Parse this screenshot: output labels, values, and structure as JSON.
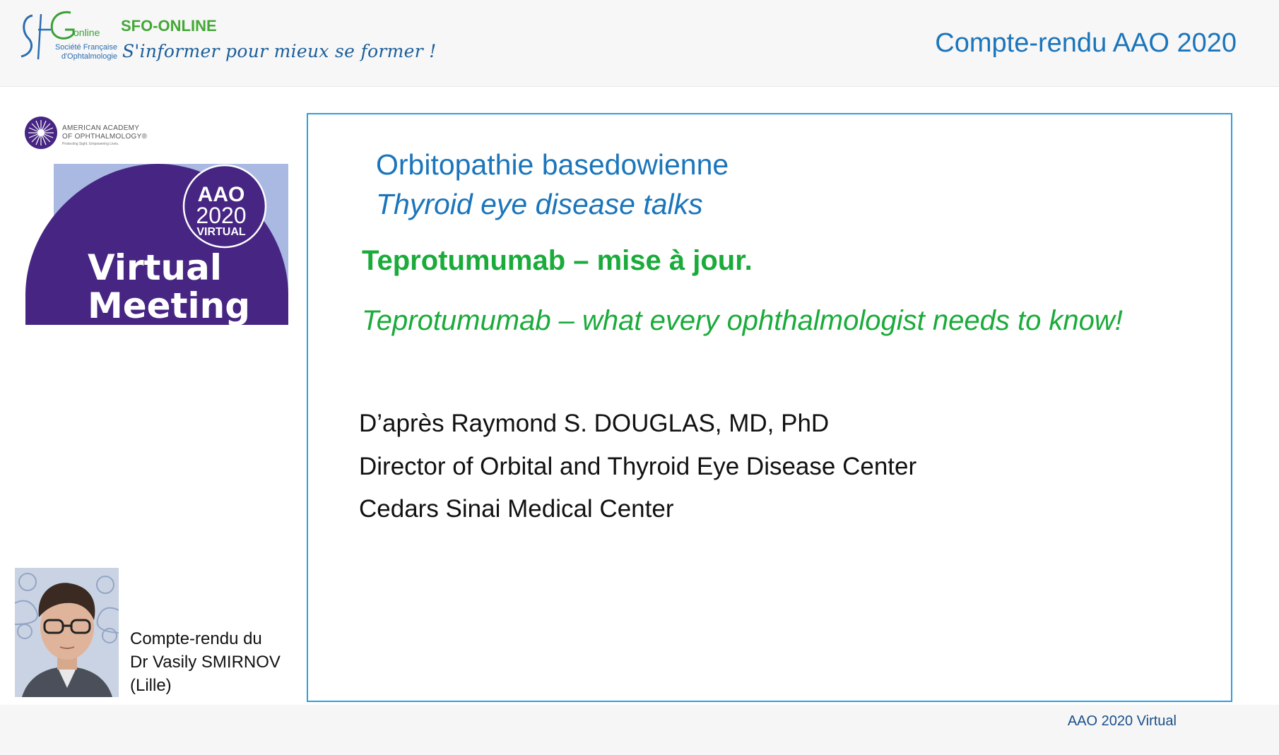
{
  "header": {
    "logo": {
      "mark": "SF",
      "word": "online",
      "society_line1": "Société Française",
      "society_line2": "d'Ophtalmologie"
    },
    "brand_name": "SFO-ONLINE",
    "tagline": "S'informer pour mieux se former !",
    "title": "Compte-rendu AAO 2020"
  },
  "aao_logo": {
    "name_line1": "AMERICAN ACADEMY",
    "name_line2": "OF OPHTHALMOLOGY®",
    "motto": "Protecting Sight. Empowering Lives."
  },
  "virtual_meeting_logo": {
    "badge_aao": "AAO",
    "badge_year": "2020",
    "badge_virtual": "VIRTUAL",
    "line1": "Virtual",
    "line2": "Meeting",
    "colors": {
      "purple": "#472583",
      "lavender": "#a9b9e2"
    }
  },
  "credit": {
    "line1": "Compte-rendu du",
    "line2": "Dr Vasily SMIRNOV",
    "line3": "(Lille)"
  },
  "content": {
    "topic_fr": "Orbitopathie basedowienne",
    "topic_en": "Thyroid eye disease talks",
    "talk_fr": "Teprotumumab – mise à jour.",
    "talk_en": "Teprotumumab – what every ophthalmologist needs to know!",
    "author": "D’après Raymond S. DOUGLAS, MD, PhD",
    "role": "Director of Orbital and Thyroid Eye Disease Center",
    "institution": "Cedars Sinai Medical Center"
  },
  "footer": {
    "text": "AAO 2020 Virtual"
  },
  "colors": {
    "blue_title": "#1b75bb",
    "green": "#1aab3a",
    "box_border": "#2e9fd9"
  }
}
